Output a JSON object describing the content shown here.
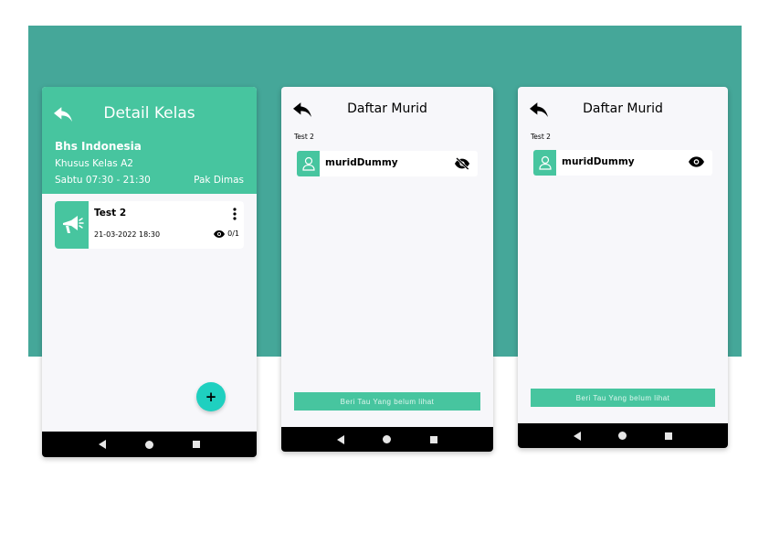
{
  "screen1": {
    "title": "Detail Kelas",
    "course_name": "Bhs Indonesia",
    "class_name": "Khusus Kelas A2",
    "schedule": "Sabtu 07:30 - 21:30",
    "teacher": "Pak Dimas",
    "announcement": {
      "title": "Test 2",
      "datetime": "21-03-2022 18:30",
      "views": "0/1",
      "icon": "megaphone-icon"
    },
    "fab_label": "+"
  },
  "screen2": {
    "title": "Daftar Murid",
    "subtitle": "Test 2",
    "student_name": "muridDummy",
    "seen_icon": "eye-off-icon",
    "notify_button": "Beri Tau Yang belum lihat"
  },
  "screen3": {
    "title": "Daftar Murid",
    "subtitle": "Test 2",
    "student_name": "muridDummy",
    "seen_icon": "eye-icon",
    "notify_button": "Beri Tau Yang belum lihat"
  },
  "colors": {
    "background_band": "#45a799",
    "accent": "#47c59f",
    "fab": "#1fd0c0",
    "navbar": "#000000"
  }
}
